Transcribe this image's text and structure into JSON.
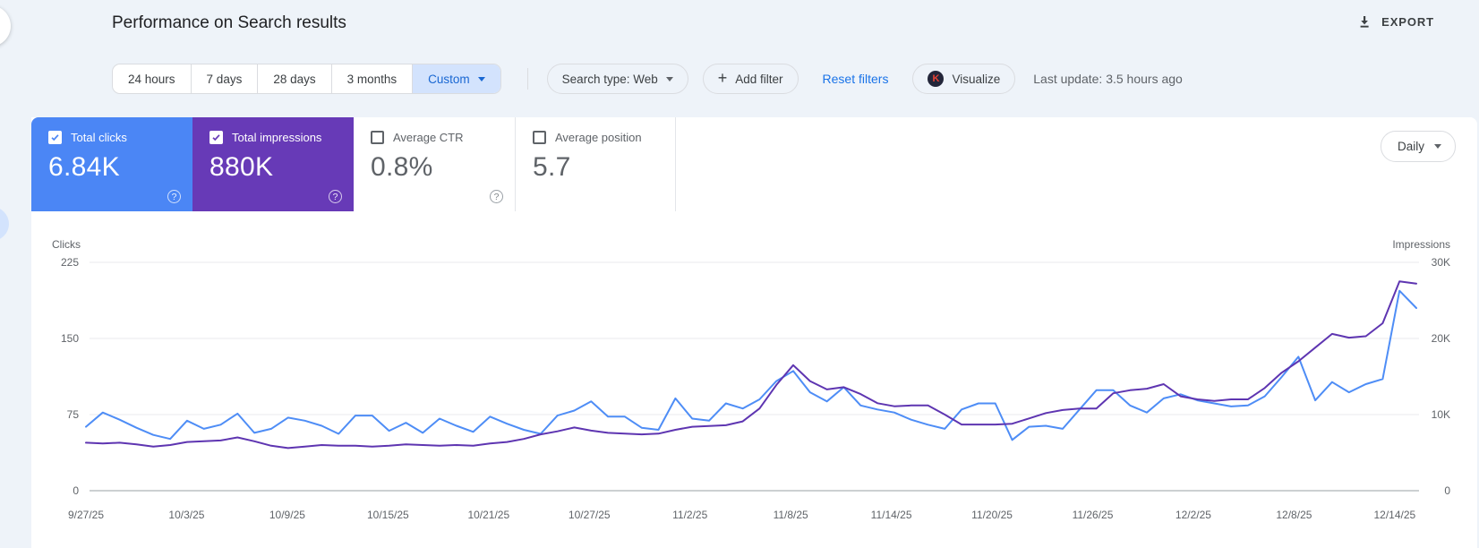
{
  "header": {
    "title": "Performance on Search results",
    "export_label": "EXPORT"
  },
  "filters": {
    "date_ranges": [
      "24 hours",
      "7 days",
      "28 days",
      "3 months"
    ],
    "custom_label": "Custom",
    "search_type_label": "Search type: Web",
    "add_filter_label": "Add filter",
    "reset_filters_label": "Reset filters",
    "visualize_label": "Visualize",
    "visualize_badge": "K",
    "last_update": "Last update: 3.5 hours ago"
  },
  "metrics": [
    {
      "label": "Total clicks",
      "value": "6.84K",
      "checked": true,
      "color": "#4b86f5"
    },
    {
      "label": "Total impressions",
      "value": "880K",
      "checked": true,
      "color": "#673ab7"
    },
    {
      "label": "Average CTR",
      "value": "0.8%",
      "checked": false
    },
    {
      "label": "Average position",
      "value": "5.7",
      "checked": false
    }
  ],
  "granularity": {
    "label": "Daily"
  },
  "chart_data": {
    "type": "line",
    "title": "Clicks and impressions over time (daily)",
    "x_tick_labels": [
      "9/27/25",
      "10/3/25",
      "10/9/25",
      "10/15/25",
      "10/21/25",
      "10/27/25",
      "11/2/25",
      "11/8/25",
      "11/14/25",
      "11/20/25",
      "11/26/25",
      "12/2/25",
      "12/8/25",
      "12/14/25"
    ],
    "y_left": {
      "label": "Clicks",
      "ticks": [
        "225",
        "150",
        "75",
        "0"
      ],
      "max": 225
    },
    "y_right": {
      "label": "Impressions",
      "ticks": [
        "30K",
        "20K",
        "10K",
        "0"
      ],
      "max": 30000
    },
    "grid": true,
    "legend_position": "none",
    "series": [
      {
        "name": "Total clicks",
        "axis": "left",
        "color": "#4e8df6",
        "values": [
          63,
          77,
          70,
          62,
          55,
          51,
          69,
          61,
          65,
          76,
          57,
          61,
          72,
          69,
          64,
          56,
          74,
          74,
          59,
          67,
          57,
          71,
          64,
          58,
          73,
          66,
          60,
          56,
          74,
          79,
          88,
          73,
          73,
          62,
          60,
          91,
          71,
          69,
          86,
          81,
          90,
          108,
          118,
          97,
          88,
          102,
          84,
          80,
          77,
          70,
          65,
          61,
          80,
          86,
          86,
          50,
          63,
          64,
          61,
          80,
          99,
          99,
          84,
          77,
          91,
          95,
          89,
          86,
          83,
          84,
          93,
          112,
          132,
          89,
          107,
          97,
          105,
          110,
          197,
          180
        ]
      },
      {
        "name": "Total impressions",
        "axis": "right",
        "color": "#5e35b1",
        "values": [
          6300,
          6200,
          6300,
          6100,
          5800,
          6000,
          6400,
          6500,
          6600,
          7000,
          6500,
          5900,
          5600,
          5800,
          6000,
          5900,
          5900,
          5800,
          5900,
          6100,
          6000,
          5900,
          6000,
          5900,
          6200,
          6400,
          6800,
          7400,
          7800,
          8300,
          7900,
          7600,
          7500,
          7400,
          7500,
          8000,
          8400,
          8500,
          8600,
          9100,
          10800,
          13900,
          16500,
          14400,
          13300,
          13600,
          12700,
          11500,
          11100,
          11200,
          11200,
          10000,
          8700,
          8700,
          8700,
          8800,
          9500,
          10200,
          10600,
          10800,
          10800,
          12800,
          13200,
          13400,
          14000,
          12400,
          12000,
          11800,
          12000,
          12000,
          13500,
          15500,
          17000,
          18800,
          20600,
          20100,
          20300,
          22000,
          27500,
          27200
        ]
      }
    ]
  }
}
